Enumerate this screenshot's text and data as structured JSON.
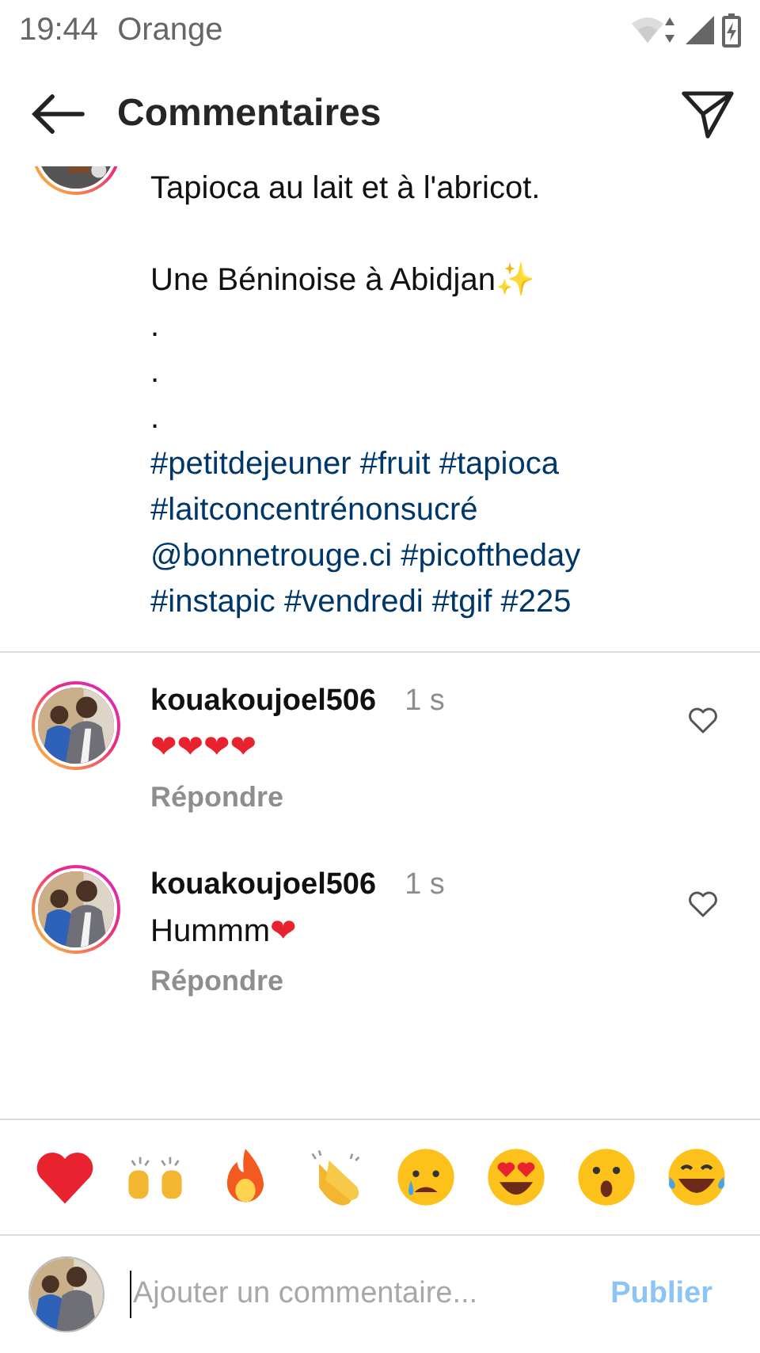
{
  "status_bar": {
    "time": "19:44",
    "carrier": "Orange"
  },
  "header": {
    "title": "Commentaires"
  },
  "caption": {
    "paragraphs": [
      {
        "lines": [
          {
            "kind": "text",
            "text": "Tapioca au lait et à l'abricot."
          }
        ]
      },
      {
        "lines": [
          {
            "kind": "text",
            "text": "Une Béninoise à Abidjan✨"
          },
          {
            "kind": "text",
            "text": "."
          },
          {
            "kind": "text",
            "text": "."
          },
          {
            "kind": "text",
            "text": "."
          },
          {
            "kind": "tags",
            "text": "#petitdejeuner #fruit #tapioca"
          },
          {
            "kind": "tags",
            "text": "#laitconcentrénonsucré"
          },
          {
            "kind": "tags",
            "text": "@bonnetrouge.ci #picoftheday"
          },
          {
            "kind": "tags",
            "text": "#instapic #vendredi #tgif #225"
          }
        ]
      }
    ]
  },
  "comments": [
    {
      "username": "kouakoujoel506",
      "time": "1 s",
      "text": "❤❤❤❤",
      "reply": "Répondre",
      "liked": false
    },
    {
      "username": "kouakoujoel506",
      "time": "1 s",
      "text": "Hummm❤",
      "reply": "Répondre",
      "liked": false
    }
  ],
  "composer": {
    "placeholder": "Ajouter un commentaire...",
    "button": "Publier",
    "disabled": true
  }
}
